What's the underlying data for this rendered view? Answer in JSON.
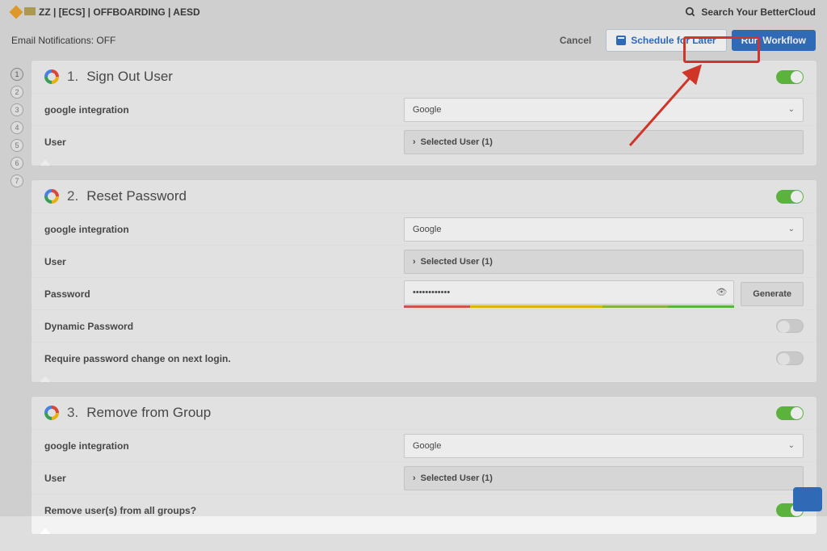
{
  "header": {
    "breadcrumb": "ZZ | [ECS] | OFFBOARDING | AESD",
    "search_label": "Search Your BetterCloud"
  },
  "actions": {
    "email_notifications_label": "Email Notifications:",
    "email_notifications_value": "OFF",
    "cancel": "Cancel",
    "schedule": "Schedule for Later",
    "run": "Run Workflow"
  },
  "timeline_steps": [
    "1",
    "2",
    "3",
    "4",
    "5",
    "6",
    "7"
  ],
  "steps": [
    {
      "number": "1.",
      "title": "Sign Out User",
      "enabled": true,
      "rows": [
        {
          "label": "google integration",
          "type": "select",
          "value": "Google"
        },
        {
          "label": "User",
          "type": "select-dark",
          "value": "Selected User (1)"
        }
      ]
    },
    {
      "number": "2.",
      "title": "Reset Password",
      "enabled": true,
      "rows": [
        {
          "label": "google integration",
          "type": "select",
          "value": "Google"
        },
        {
          "label": "User",
          "type": "select-dark",
          "value": "Selected User (1)"
        },
        {
          "label": "Password",
          "type": "password",
          "value": "••••••••••••",
          "generate": "Generate"
        },
        {
          "label": "Dynamic Password",
          "type": "toggle",
          "on": false
        },
        {
          "label": "Require password change on next login.",
          "type": "toggle",
          "on": false
        }
      ]
    },
    {
      "number": "3.",
      "title": "Remove from Group",
      "enabled": true,
      "rows": [
        {
          "label": "google integration",
          "type": "select",
          "value": "Google"
        },
        {
          "label": "User",
          "type": "select-dark",
          "value": "Selected User (1)"
        },
        {
          "label": "Remove user(s) from all groups?",
          "type": "toggle",
          "on": true
        }
      ]
    }
  ]
}
